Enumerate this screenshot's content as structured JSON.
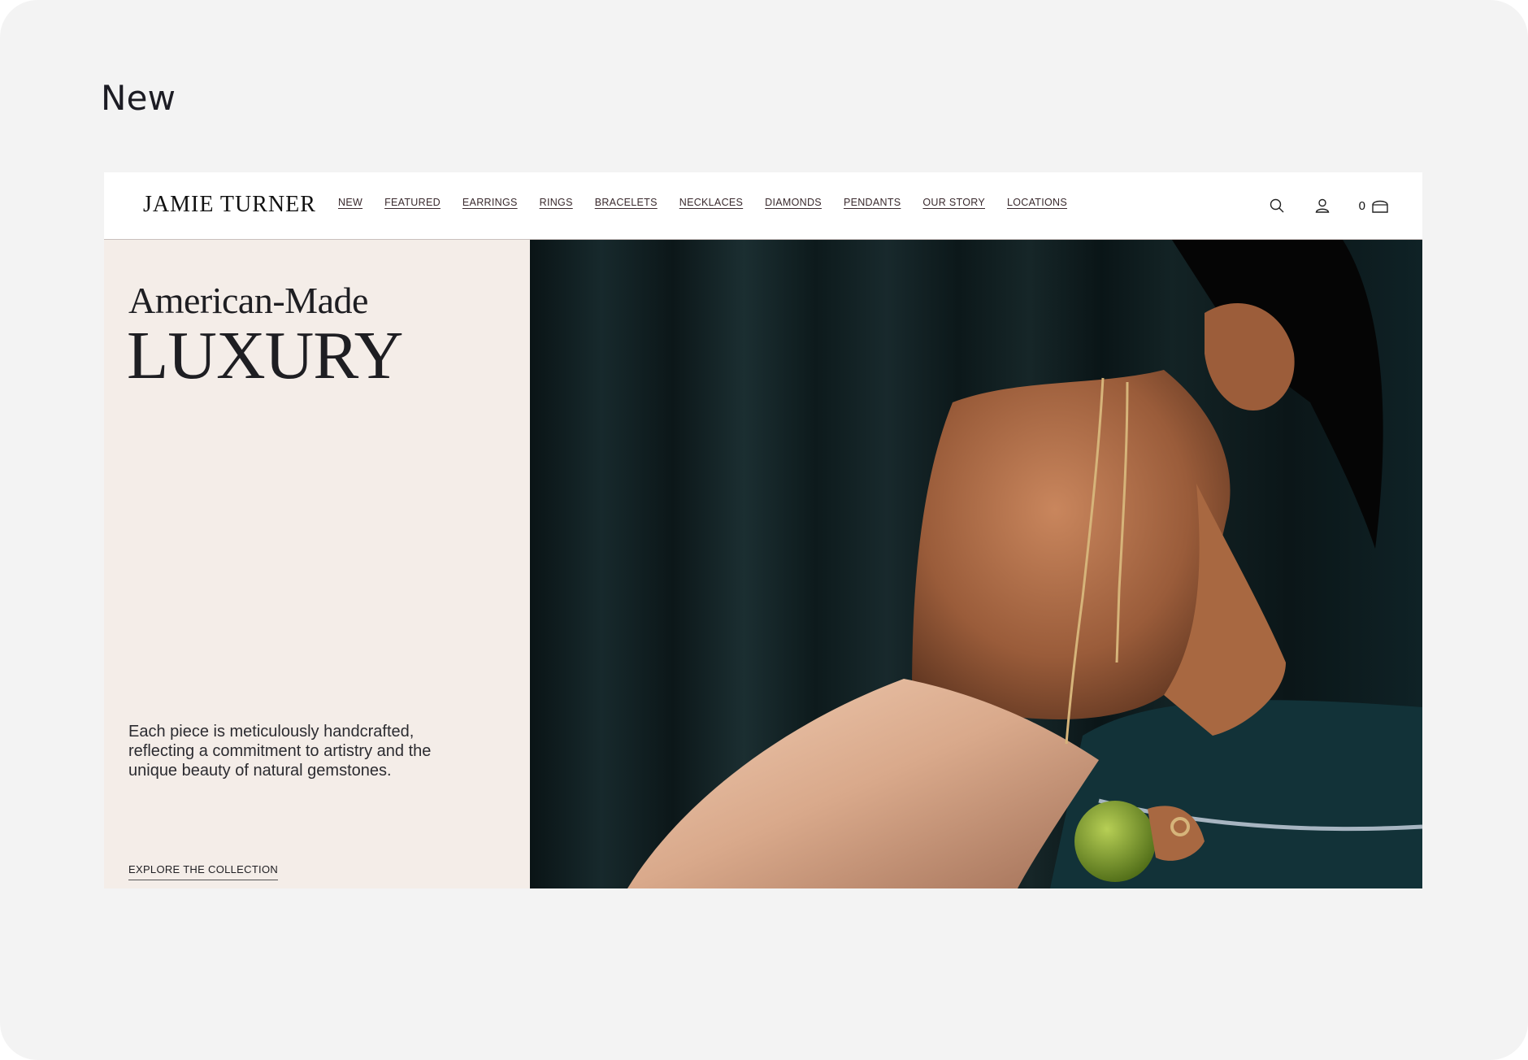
{
  "section": {
    "title": "New"
  },
  "header": {
    "logo": "JAMIE TURNER",
    "nav": [
      "NEW",
      "FEATURED",
      "EARRINGS",
      "RINGS",
      "BRACELETS",
      "NECKLACES",
      "DIAMONDS",
      "PENDANTS",
      "OUR STORY",
      "LOCATIONS"
    ],
    "cart_count": "0",
    "icons": [
      "search-icon",
      "account-icon",
      "bag-icon"
    ]
  },
  "hero": {
    "headline_small": "American-Made",
    "headline_large": "LUXURY",
    "description": "Each piece is meticulously handcrafted, reflecting a commitment to artistry and the unique beauty of natural gemstones.",
    "cta": "EXPLORE THE COLLECTION"
  },
  "colors": {
    "page_bg": "#f3f3f3",
    "panel_bg": "#f4ede8",
    "text": "#1e1e22",
    "photo_bg": "#0b1517"
  }
}
